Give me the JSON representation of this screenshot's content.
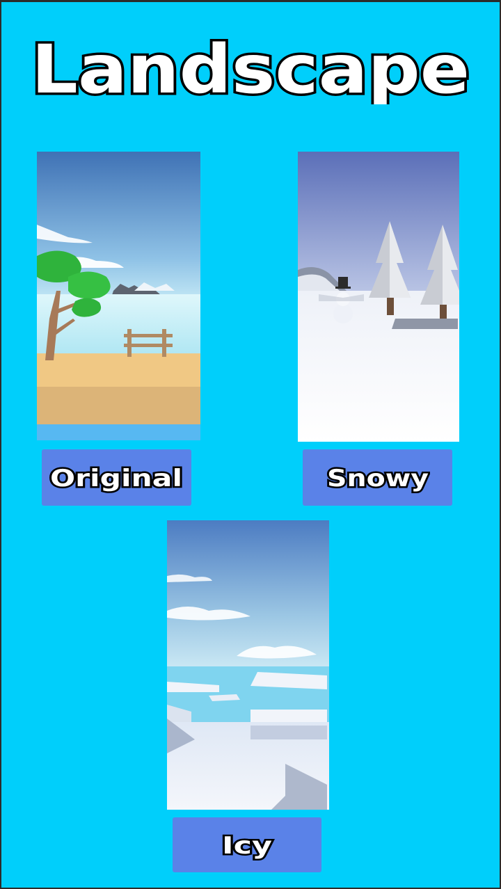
{
  "header": {
    "title": "Landscape"
  },
  "options": [
    {
      "id": "original",
      "label": "Original"
    },
    {
      "id": "snowy",
      "label": "Snowy"
    },
    {
      "id": "icy",
      "label": "Icy"
    }
  ],
  "colors": {
    "background": "#00cffb",
    "button": "#5a82e8",
    "title_fill": "#ffffff",
    "title_stroke": "#000000"
  }
}
